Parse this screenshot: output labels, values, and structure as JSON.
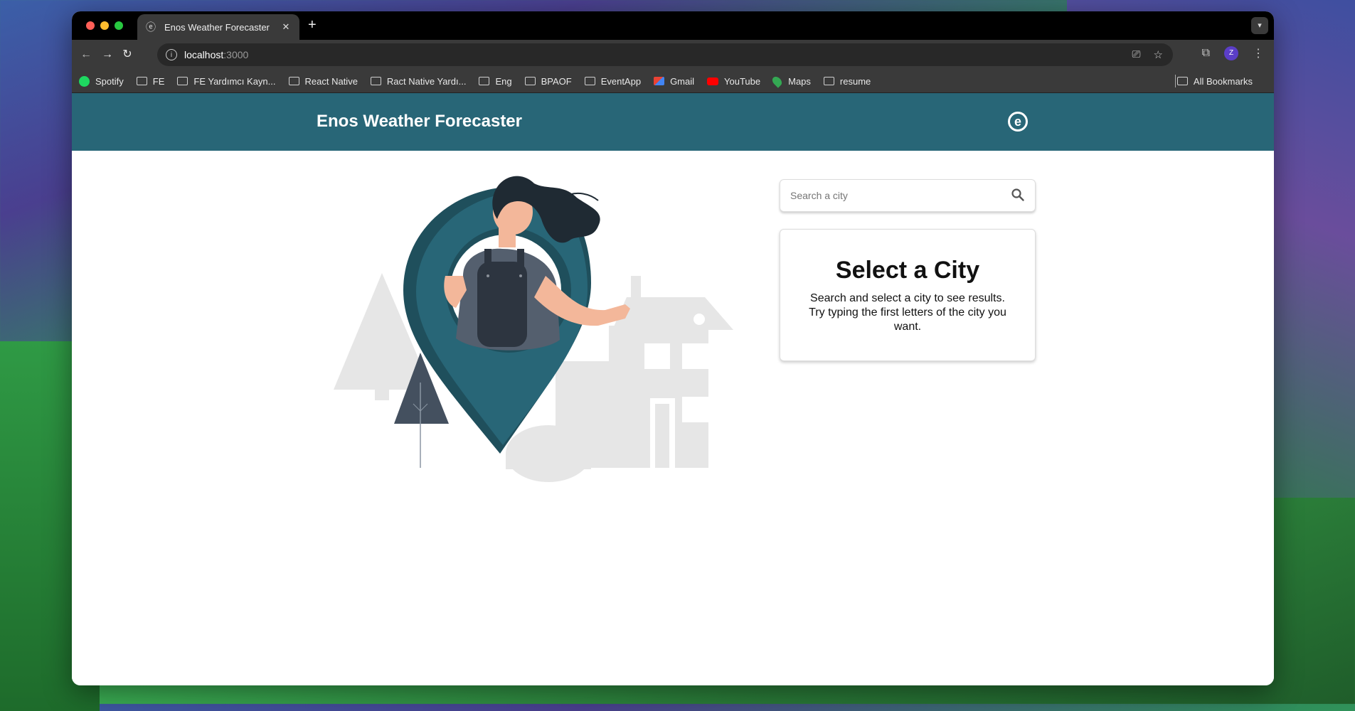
{
  "browser": {
    "tab_title": "Enos Weather Forecaster",
    "url_host": "localhost",
    "url_port": ":3000",
    "profile_initial": "Z"
  },
  "bookmarks": [
    {
      "label": "Spotify",
      "icon": "spotify-icon"
    },
    {
      "label": "FE",
      "icon": "folder-icon"
    },
    {
      "label": "FE Yardımcı Kayn...",
      "icon": "folder-icon"
    },
    {
      "label": "React Native",
      "icon": "folder-icon"
    },
    {
      "label": "Ract Native Yardı...",
      "icon": "folder-icon"
    },
    {
      "label": "Eng",
      "icon": "folder-icon"
    },
    {
      "label": "BPAOF",
      "icon": "folder-icon"
    },
    {
      "label": "EventApp",
      "icon": "folder-icon"
    },
    {
      "label": "Gmail",
      "icon": "gmail-icon"
    },
    {
      "label": "YouTube",
      "icon": "youtube-icon"
    },
    {
      "label": "Maps",
      "icon": "maps-icon"
    },
    {
      "label": "resume",
      "icon": "folder-icon"
    }
  ],
  "all_bookmarks_label": "All Bookmarks",
  "app": {
    "title": "Enos Weather Forecaster",
    "search_placeholder": "Search a city",
    "card_title": "Select a City",
    "card_text": "Search and select a city to see results. Try typing the first letters of the city you want."
  },
  "colors": {
    "header_bg": "#286677",
    "pin_dark": "#1f4f5c",
    "pin": "#286677",
    "accent_tree": "#44505f"
  }
}
